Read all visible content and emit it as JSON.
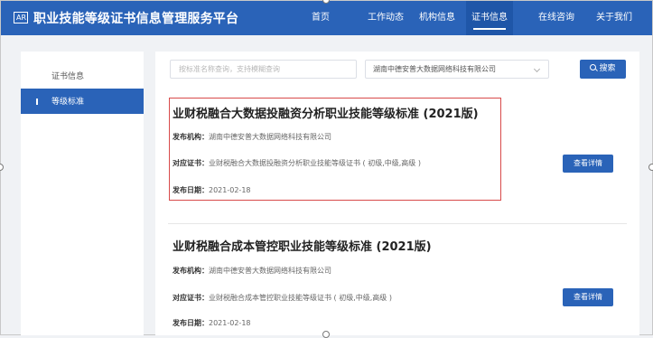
{
  "header": {
    "logo_text": "AR",
    "title": "职业技能等级证书信息管理服务平台",
    "nav": [
      {
        "label": "首页",
        "active": false
      },
      {
        "label": "工作动态",
        "active": false
      },
      {
        "label": "机构信息",
        "active": false
      },
      {
        "label": "证书信息",
        "active": true
      },
      {
        "label": "在线咨询",
        "active": false
      },
      {
        "label": "关于我们",
        "active": false
      }
    ]
  },
  "sidebar": {
    "title": "证书信息",
    "items": [
      {
        "label": "等级标准",
        "active": true
      }
    ]
  },
  "search": {
    "placeholder": "按标准名称查询，支持模糊查询",
    "org_selected": "湖南中德安普大数据网络科技有限公司",
    "button_label": "搜索"
  },
  "labels": {
    "org": "发布机构：",
    "cert": "对应证书：",
    "date": "发布日期：",
    "detail_button": "查看详情"
  },
  "standards": [
    {
      "title": "业财税融合大数据投融资分析职业技能等级标准 (2021版)",
      "org": "湖南中德安普大数据网络科技有限公司",
      "cert": "业财税融合大数据投融资分析职业技能等级证书 ( 初级,中级,高级 )",
      "date": "2021-02-18"
    },
    {
      "title": "业财税融合成本管控职业技能等级标准 (2021版)",
      "org": "湖南中德安普大数据网络科技有限公司",
      "cert": "业财税融合成本管控职业技能等级证书 ( 初级,中级,高级 )",
      "date": "2021-02-18"
    }
  ],
  "colors": {
    "primary": "#2a63b8",
    "highlight_border": "#d84a4a",
    "page_bg": "#f0f2f5"
  }
}
